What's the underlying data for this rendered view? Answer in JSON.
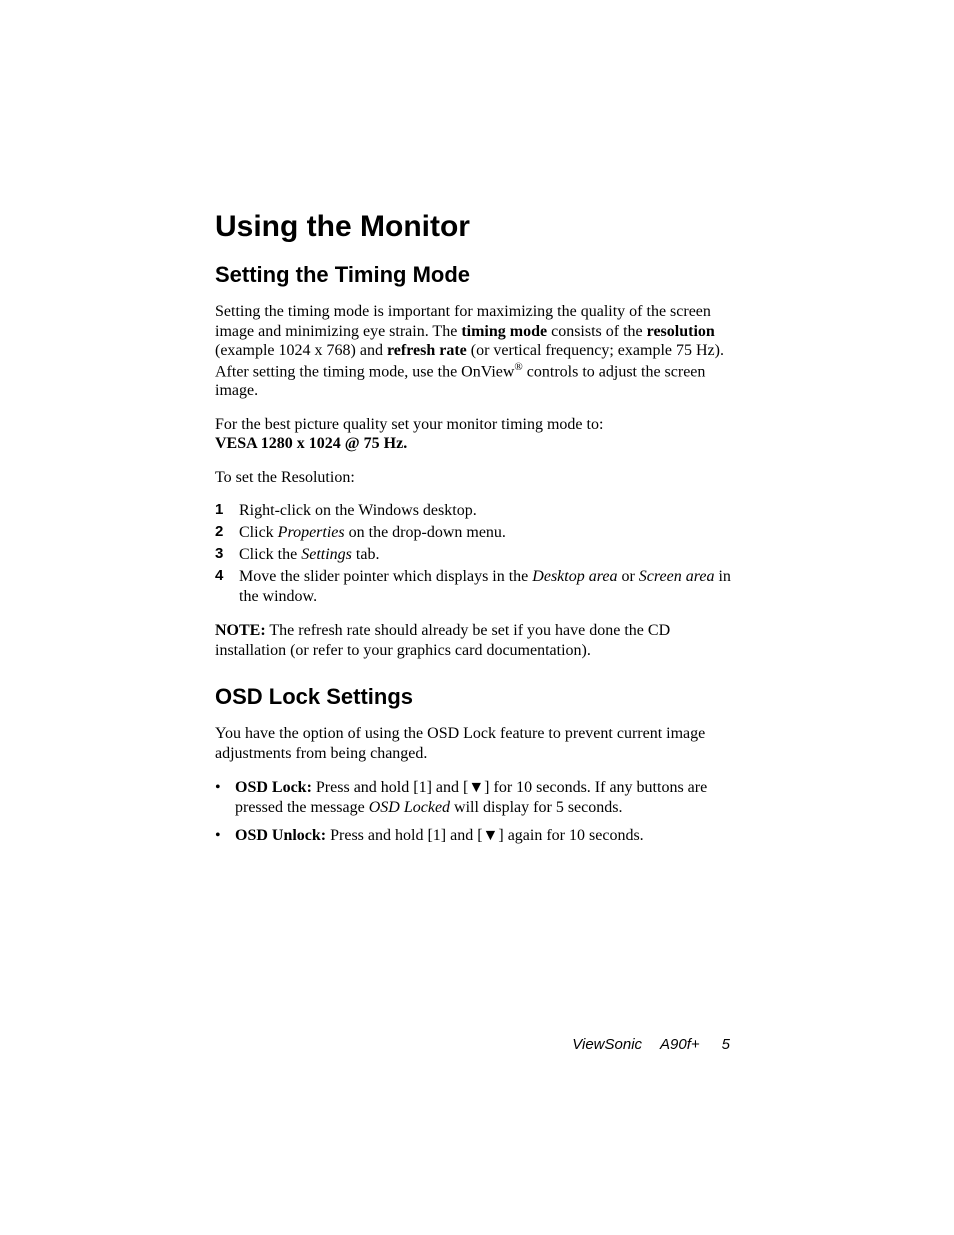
{
  "h1": "Using the Monitor",
  "section1": {
    "h2": "Setting the Timing Mode",
    "para1": {
      "t1": "Setting the timing mode is important for maximizing the quality of the screen image and minimizing eye strain. The ",
      "b1": "timing mode",
      "t2": " consists of the ",
      "b2": "resolution",
      "t3": " (example 1024 x 768) and ",
      "b3": "refresh rate",
      "t4": " (or vertical frequency; example 75 Hz). After setting the timing mode, use the OnView",
      "reg": "®",
      "t5": " controls to adjust the screen image."
    },
    "para2": {
      "t1": "For the best picture quality set your monitor timing mode to: ",
      "b1": "VESA 1280 x 1024 @ 75 Hz."
    },
    "para3": "To set the Resolution:",
    "steps": [
      {
        "n": "1",
        "t1": "Right-click on the Windows desktop."
      },
      {
        "n": "2",
        "t1": "Click ",
        "i1": "Properties",
        "t2": " on the drop-down menu."
      },
      {
        "n": "3",
        "t1": "Click the ",
        "i1": "Settings",
        "t2": " tab."
      },
      {
        "n": "4",
        "t1": "Move the slider pointer which displays in the ",
        "i1": "Desktop area",
        "t2": " or ",
        "i2": "Screen area",
        "t3": " in the window."
      }
    ],
    "note": {
      "b1": "NOTE:",
      "t1": " The refresh rate should already be set if you have done the CD installation (or refer to your graphics card documentation)."
    }
  },
  "section2": {
    "h2": "OSD Lock Settings",
    "para1": "You have the option of using the OSD Lock feature to prevent current image adjustments from being changed.",
    "bullets": [
      {
        "b1": "OSD Lock:",
        "t1": " Press and hold [1] and [▼] for 10 seconds. If any buttons are pressed the message ",
        "i1": "OSD Locked",
        "t2": " will display for 5 seconds."
      },
      {
        "b1": "OSD Unlock:",
        "t1": " Press and hold [1] and [▼] again for 10 seconds."
      }
    ]
  },
  "footer": {
    "brand": "ViewSonic",
    "model": "A90f+",
    "page": "5"
  }
}
